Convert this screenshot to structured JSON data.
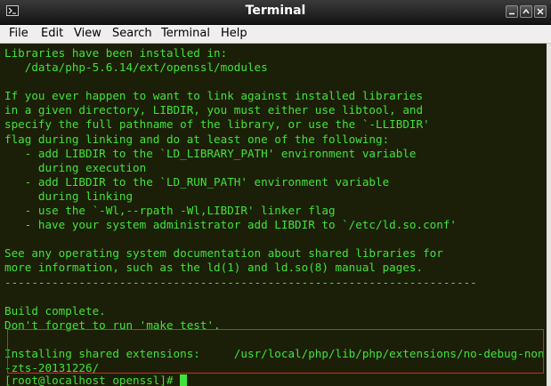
{
  "window": {
    "title": "Terminal"
  },
  "menu": [
    {
      "label": "File"
    },
    {
      "label": "Edit"
    },
    {
      "label": "View"
    },
    {
      "label": "Search"
    },
    {
      "label": "Terminal"
    },
    {
      "label": "Help"
    }
  ],
  "terminal": {
    "lines": [
      "Libraries have been installed in:",
      "   /data/php-5.6.14/ext/openssl/modules",
      "",
      "If you ever happen to want to link against installed libraries",
      "in a given directory, LIBDIR, you must either use libtool, and",
      "specify the full pathname of the library, or use the `-LLIBDIR'",
      "flag during linking and do at least one of the following:",
      "   - add LIBDIR to the `LD_LIBRARY_PATH' environment variable",
      "     during execution",
      "   - add LIBDIR to the `LD_RUN_PATH' environment variable",
      "     during linking",
      "   - use the `-Wl,--rpath -Wl,LIBDIR' linker flag",
      "   - have your system administrator add LIBDIR to `/etc/ld.so.conf'",
      "",
      "See any operating system documentation about shared libraries for",
      "more information, such as the ld(1) and ld.so(8) manual pages.",
      "----------------------------------------------------------------------",
      "",
      "Build complete.",
      "Don't forget to run 'make test'.",
      "",
      "Installing shared extensions:     /usr/local/php/lib/php/extensions/no-debug-non",
      "-zts-20131226/"
    ],
    "prompt": "[root@localhost openssl]# "
  },
  "colors": {
    "terminal_bg": "#1b1f07",
    "terminal_fg": "#41e33a",
    "highlight_border": "#e02424"
  }
}
